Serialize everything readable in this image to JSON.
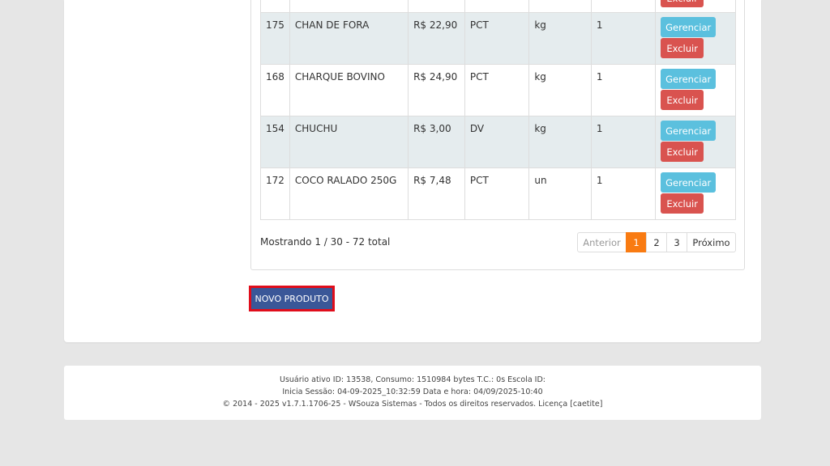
{
  "table": {
    "manage_label": "Gerenciar",
    "delete_label": "Excluir",
    "rows": [
      {
        "id": "175",
        "name": "CHAN DE FORA",
        "price": "R$ 22,90",
        "package": "PCT",
        "unit": "kg",
        "qty": "1"
      },
      {
        "id": "168",
        "name": "CHARQUE BOVINO",
        "price": "R$ 24,90",
        "package": "PCT",
        "unit": "kg",
        "qty": "1"
      },
      {
        "id": "154",
        "name": "CHUCHU",
        "price": "R$ 3,00",
        "package": "DV",
        "unit": "kg",
        "qty": "1"
      },
      {
        "id": "172",
        "name": "COCO RALADO 250G",
        "price": "R$ 7,48",
        "package": "PCT",
        "unit": "un",
        "qty": "1"
      }
    ]
  },
  "summary": "Mostrando 1 / 30 - 72 total",
  "pagination": {
    "prev": "Anterior",
    "pages": [
      "1",
      "2",
      "3"
    ],
    "active_page": "1",
    "next": "Próximo"
  },
  "new_product_button": "NOVO PRODUTO",
  "footer": {
    "line1": "Usuário ativo ID: 13538, Consumo: 1510984 bytes T.C.: 0s Escola ID:",
    "line2": "Inicia Sessão: 04-09-2025_10:32:59 Data e hora: 04/09/2025-10:40",
    "line3": "© 2014 - 2025 v1.7.1.1706-25 - WSouza Sistemas - Todos os direitos reservados. Licença [caetite]"
  },
  "colors": {
    "manage": "#5bc0de",
    "delete": "#d9534f",
    "active_page": "#f97b12",
    "new_button": "#3a5798",
    "highlight_border": "#e00d1b"
  }
}
